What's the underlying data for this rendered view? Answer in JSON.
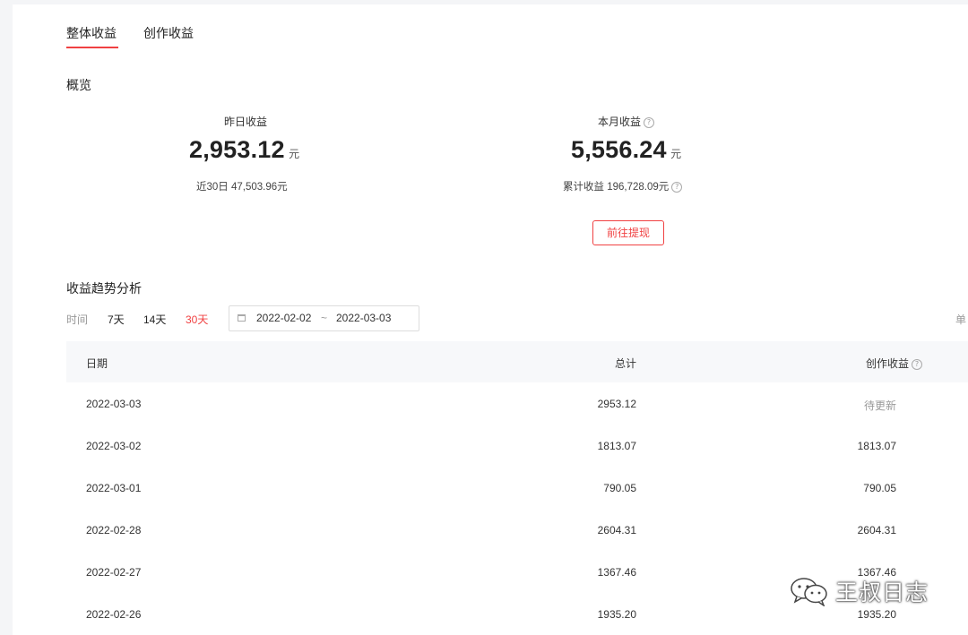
{
  "tabs": [
    {
      "label": "整体收益",
      "active": true
    },
    {
      "label": "创作收益",
      "active": false
    }
  ],
  "overview": {
    "title": "概览",
    "yesterday": {
      "label": "昨日收益",
      "amount": "2,953.12",
      "unit": "元",
      "sub": "近30日 47,503.96元"
    },
    "month": {
      "label": "本月收益",
      "amount": "5,556.24",
      "unit": "元",
      "sub": "累计收益 196,728.09元"
    },
    "withdraw_button": "前往提现"
  },
  "trend": {
    "title": "收益趋势分析",
    "time_label": "时间",
    "options": [
      "7天",
      "14天",
      "30天"
    ],
    "active_option": "30天",
    "date_start": "2022-02-02",
    "date_sep": "~",
    "date_end": "2022-03-03",
    "unit_label": "单"
  },
  "table": {
    "headers": [
      "日期",
      "总计",
      "创作收益"
    ],
    "rows": [
      {
        "date": "2022-03-03",
        "total": "2953.12",
        "create": "待更新"
      },
      {
        "date": "2022-03-02",
        "total": "1813.07",
        "create": "1813.07"
      },
      {
        "date": "2022-03-01",
        "total": "790.05",
        "create": "790.05"
      },
      {
        "date": "2022-02-28",
        "total": "2604.31",
        "create": "2604.31"
      },
      {
        "date": "2022-02-27",
        "total": "1367.46",
        "create": "1367.46"
      },
      {
        "date": "2022-02-26",
        "total": "1935.20",
        "create": "1935.20"
      }
    ]
  },
  "watermark": {
    "text": "王叔日志",
    "icon": "wechat-icon"
  },
  "colors": {
    "accent": "#f04142",
    "header_bg": "#f7f8fa",
    "page_bg": "#f4f5f7"
  }
}
